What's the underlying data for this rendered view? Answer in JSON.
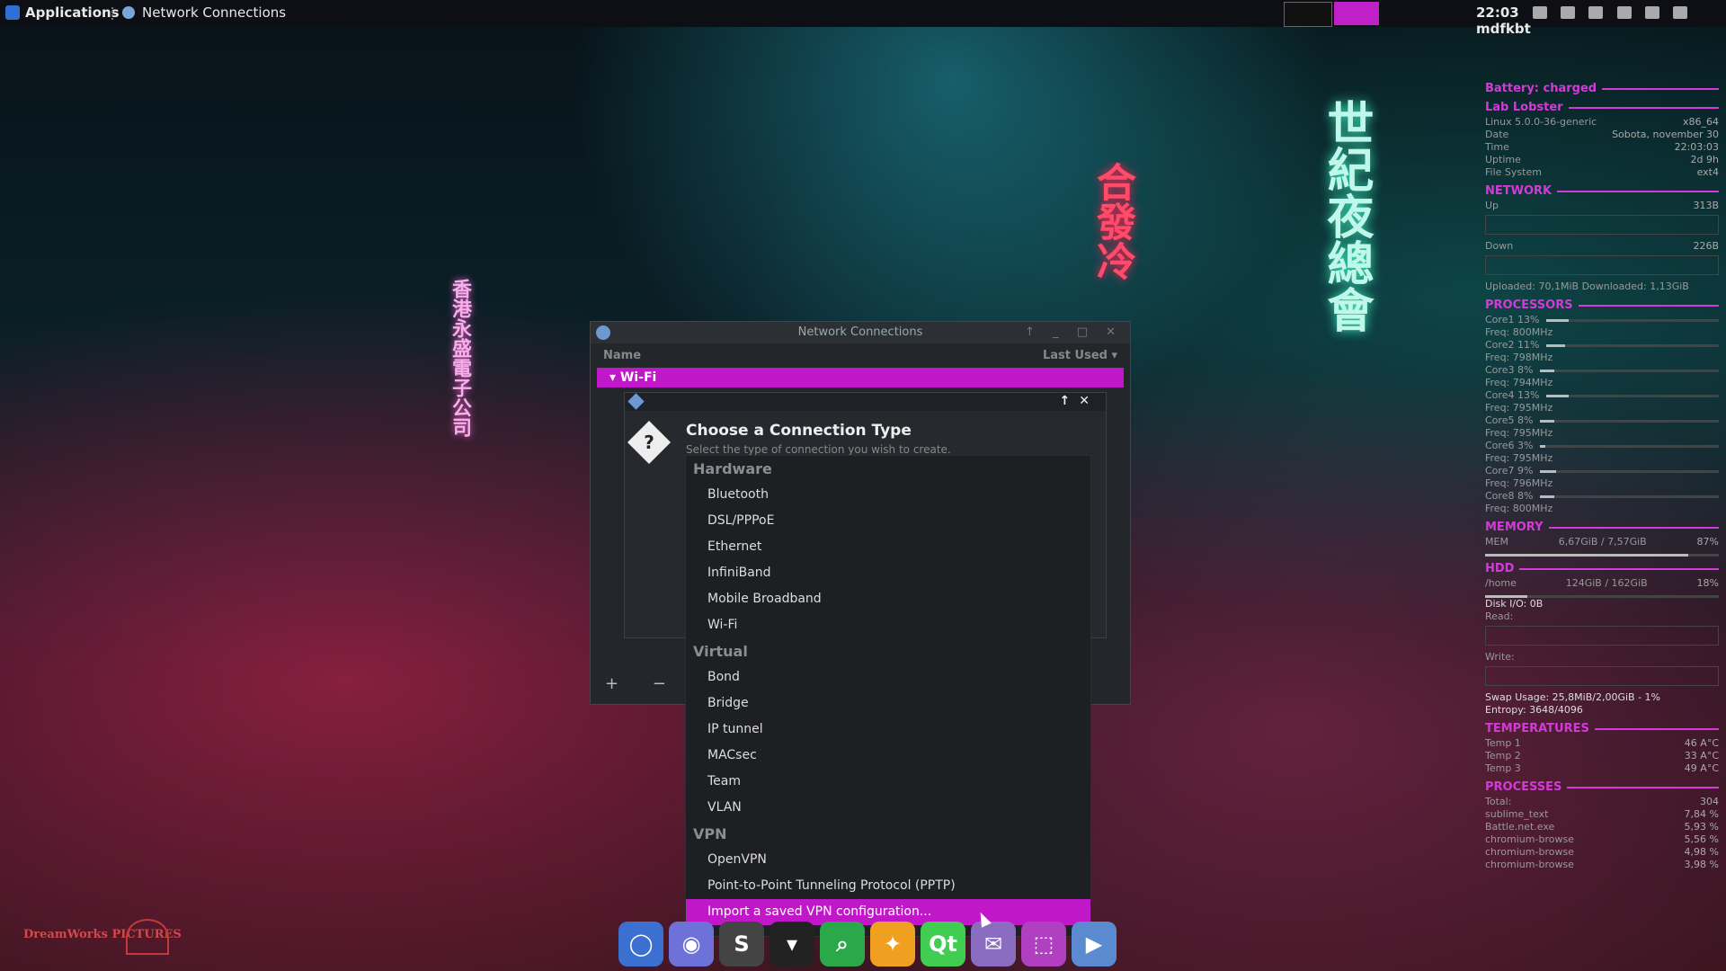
{
  "panel": {
    "applications_label": "Applications",
    "task_title": "Network Connections",
    "clock": "22:03",
    "user": "mdfkbt"
  },
  "neon_signs": {
    "left": "香港永盛電子公司",
    "right": "世紀夜總會",
    "middle": "合發冷"
  },
  "conky": {
    "battery": "Battery: charged",
    "host": "Lab Lobster",
    "kernel": "Linux 5.0.0-36-generic",
    "arch": "x86_64",
    "sysinfo": [
      {
        "k": "Date",
        "v": "Sobota, november 30"
      },
      {
        "k": "Time",
        "v": "22:03:03"
      },
      {
        "k": "Uptime",
        "v": "2d 9h"
      },
      {
        "k": "File System",
        "v": "ext4"
      }
    ],
    "network": {
      "title": "NETWORK",
      "up_label": "Up",
      "up_value": "313B",
      "down_label": "Down",
      "down_value": "226B",
      "totals": "Uploaded: 70,1MiB Downloaded: 1,13GiB"
    },
    "processors_title": "PROCESSORS",
    "cores": [
      {
        "label": "Core1 13%",
        "freq": "Freq: 800MHz",
        "load": 13
      },
      {
        "label": "Core2 11%",
        "freq": "Freq: 798MHz",
        "load": 11
      },
      {
        "label": "Core3 8%",
        "freq": "Freq: 794MHz",
        "load": 8
      },
      {
        "label": "Core4 13%",
        "freq": "Freq: 795MHz",
        "load": 13
      },
      {
        "label": "Core5 8%",
        "freq": "Freq: 795MHz",
        "load": 8
      },
      {
        "label": "Core6 3%",
        "freq": "Freq: 795MHz",
        "load": 3
      },
      {
        "label": "Core7 9%",
        "freq": "Freq: 796MHz",
        "load": 9
      },
      {
        "label": "Core8 8%",
        "freq": "Freq: 800MHz",
        "load": 8
      }
    ],
    "memory": {
      "title": "MEMORY",
      "label": "MEM",
      "value": "6,67GiB / 7,57GiB",
      "percent": "87%",
      "fill": 87
    },
    "hdd": {
      "title": "HDD",
      "mount": "/home",
      "value": "124GiB / 162GiB",
      "percent": "18%",
      "fill": 18,
      "disk_io": "Disk I/O: 0B",
      "read": "Read:",
      "write": "Write:"
    },
    "swap": "Swap Usage: 25,8MiB/2,00GiB - 1%",
    "entropy": "Entropy: 3648/4096",
    "temperatures": {
      "title": "TEMPERATURES",
      "items": [
        {
          "k": "Temp 1",
          "v": "46 A°C"
        },
        {
          "k": "Temp 2",
          "v": "33 A°C"
        },
        {
          "k": "Temp 3",
          "v": "49 A°C"
        }
      ]
    },
    "processes": {
      "title": "PROCESSES",
      "total_label": "Total:",
      "total": "304",
      "items": [
        {
          "k": "sublime_text",
          "v": "7,84 %"
        },
        {
          "k": "Battle.net.exe",
          "v": "5,93 %"
        },
        {
          "k": "chromium-browse",
          "v": "5,56 %"
        },
        {
          "k": "chromium-browse",
          "v": "4,98 %"
        },
        {
          "k": "chromium-browse",
          "v": "3,98 %"
        }
      ]
    }
  },
  "network_connections": {
    "title": "Network Connections",
    "col_name": "Name",
    "col_last_used": "Last Used",
    "group": "Wi-Fi",
    "footer": "+ − ⚙"
  },
  "dialog": {
    "title": "Choose a Connection Type",
    "subtitle": "Select the type of connection you wish to create."
  },
  "menu": {
    "hardware": "Hardware",
    "hardware_items": [
      "Bluetooth",
      "DSL/PPPoE",
      "Ethernet",
      "InfiniBand",
      "Mobile Broadband",
      "Wi-Fi"
    ],
    "virtual": "Virtual",
    "virtual_items": [
      "Bond",
      "Bridge",
      "IP tunnel",
      "MACsec",
      "Team",
      "VLAN"
    ],
    "vpn": "VPN",
    "vpn_items": [
      "OpenVPN",
      "Point-to-Point Tunneling Protocol (PPTP)"
    ],
    "import": "Import a saved VPN configuration..."
  },
  "dock": [
    {
      "name": "chromium-icon",
      "glyph": "◯",
      "color": "#3b6fd0"
    },
    {
      "name": "discord-icon",
      "glyph": "◉",
      "color": "#6e72d8"
    },
    {
      "name": "sublime-icon",
      "glyph": "S",
      "color": "#444"
    },
    {
      "name": "spotify-icon",
      "glyph": "▾",
      "color": "#222"
    },
    {
      "name": "search-app-icon",
      "glyph": "⌕",
      "color": "#2aa84a"
    },
    {
      "name": "app-orange-icon",
      "glyph": "✦",
      "color": "#f0a020"
    },
    {
      "name": "qt-icon",
      "glyph": "Qt",
      "color": "#41cd52"
    },
    {
      "name": "pidgin-icon",
      "glyph": "✉",
      "color": "#8a6cc0"
    },
    {
      "name": "screenshot-icon",
      "glyph": "⬚",
      "color": "#b040c0"
    },
    {
      "name": "video-icon",
      "glyph": "▶",
      "color": "#5a8ad0"
    }
  ],
  "logos": {
    "dreamworks": "DreamWorks PICTURES"
  }
}
